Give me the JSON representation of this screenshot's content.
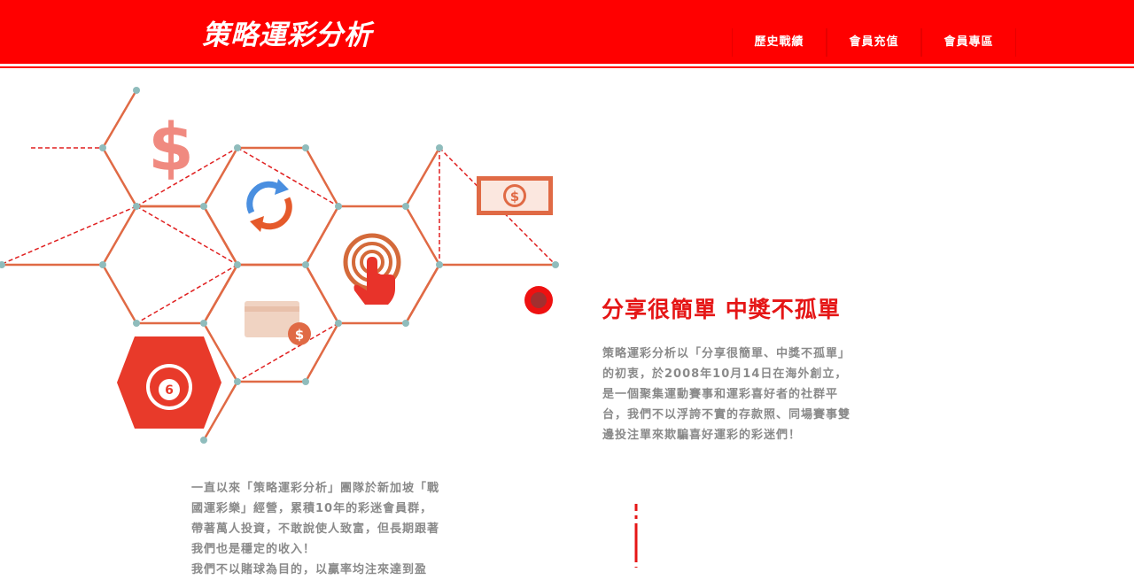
{
  "header": {
    "logo": "策略運彩分析",
    "nav": [
      {
        "label": "歷史戰績"
      },
      {
        "label": "會員充值"
      },
      {
        "label": "會員專區"
      }
    ]
  },
  "illustration": {
    "icons": [
      "dollar-icon",
      "refresh-icon",
      "cash-icon",
      "tap-icon",
      "card-icon",
      "ball-icon"
    ],
    "ball_number": "6"
  },
  "hero": {
    "headline": "分享很簡單 中獎不孤單",
    "intro": "策略運彩分析以「分享很簡單、中獎不孤單」的初衷，於2008年10月14日在海外創立，是一個聚集運動賽事和運彩喜好者的社群平台，我們不以浮誇不實的存款照、同場賽事雙邊投注單來欺騙喜好運彩的彩迷們！"
  },
  "story": {
    "lines": [
      "一直以來「策略運彩分析」團隊於新加坡「戰",
      "國運彩樂」經營，累積10年的彩迷會員群，",
      "帶著萬人投資，不敢說使人致富，但長期跟著",
      "我們也是穩定的收入！",
      "我們不以賭球為目的，以贏率均注來達到盈"
    ]
  },
  "colors": {
    "brand_red": "#ff0000",
    "hex_line": "#e06a45",
    "node": "#8fbcbc",
    "text_gray": "#8a8a8a"
  }
}
